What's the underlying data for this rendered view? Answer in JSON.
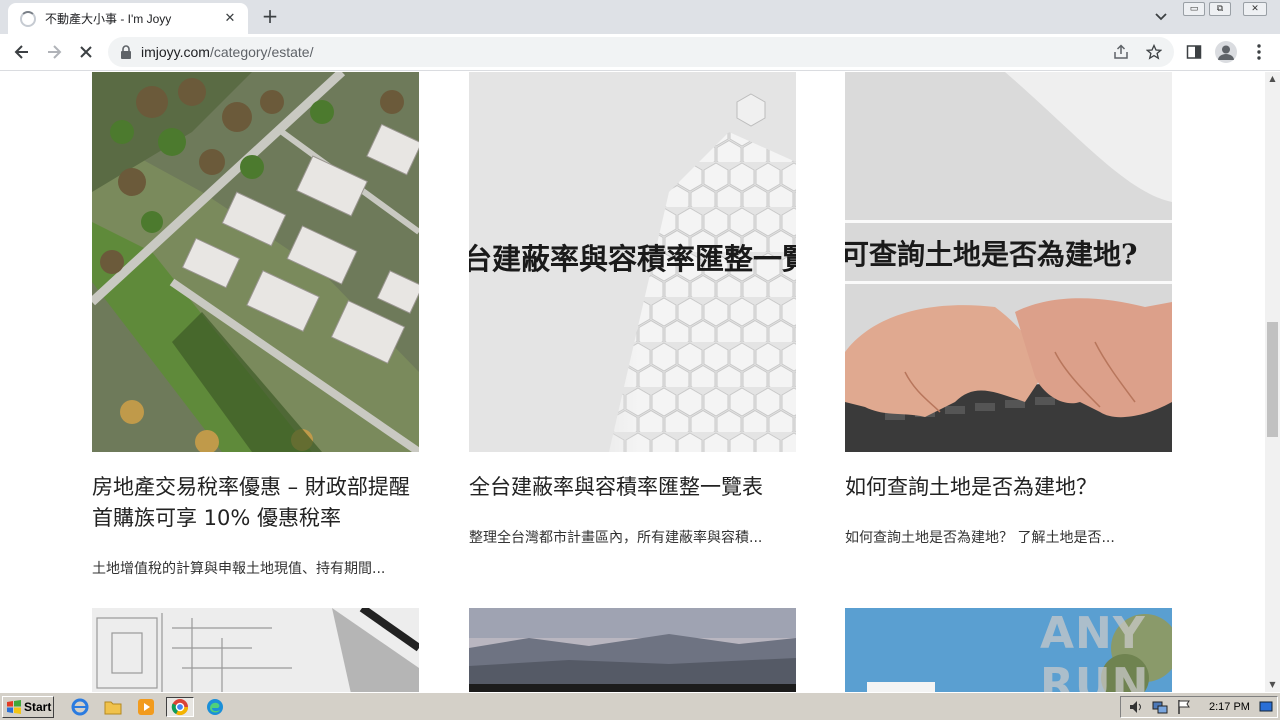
{
  "browser": {
    "tab_title": "不動產大小事 - I'm Joyy",
    "tab_close": "✕",
    "new_tab": "+",
    "url_host": "imjoyy.com",
    "url_path": "/category/estate/",
    "min_symbol": "▭",
    "restore_symbol": "⧉",
    "close_symbol": "✕"
  },
  "posts": [
    {
      "title": "房地產交易稅率優惠 – 財政部提醒首購族可享 10% 優惠稅率",
      "excerpt": "土地增值稅的計算與申報土地現值、持有期間...",
      "image": "aerial-houses"
    },
    {
      "title": "全台建蔽率與容積率匯整一覽表",
      "excerpt": "整理全台灣都市計畫區內，所有建蔽率與容積...",
      "image": "hexagon-pattern",
      "image_caption": "台建蔽率與容積率匯整一覽"
    },
    {
      "title": "如何查詢土地是否為建地？",
      "excerpt": "如何查詢土地是否為建地？ 了解土地是否...",
      "image": "hands-keyboard",
      "image_caption": "可查詢土地是否為建地?"
    }
  ],
  "watermark": "ANY RUN",
  "taskbar": {
    "start_label": "Start",
    "clock": "2:17 PM"
  },
  "colors": {
    "tabbar": "#dee1e6",
    "omnibox": "#f1f3f4",
    "taskbar": "#d4d0c8",
    "title_text": "#222222"
  }
}
